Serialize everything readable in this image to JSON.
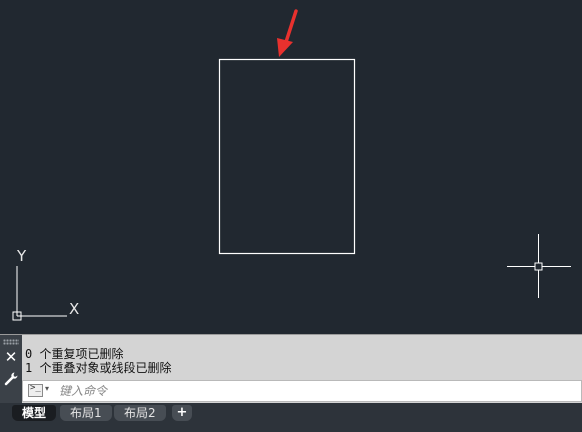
{
  "canvas": {
    "background": "#212830",
    "ucs": {
      "x_label": "X",
      "y_label": "Y"
    },
    "annotation_color": "#e8312e"
  },
  "command_line": {
    "history": [
      "0 个重复项已删除",
      "1 个重叠对象或线段已删除"
    ],
    "input_placeholder": "键入命令",
    "input_value": "",
    "prompt_glyph": ">_",
    "dropdown_glyph": "▾",
    "close_glyph": "✕"
  },
  "tabs": [
    {
      "label": "模型",
      "active": true
    },
    {
      "label": "布局1",
      "active": false
    },
    {
      "label": "布局2",
      "active": false
    }
  ],
  "add_tab_label": "+"
}
